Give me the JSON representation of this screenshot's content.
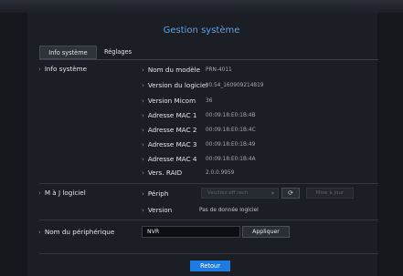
{
  "title": "Gestion système",
  "tabs": [
    {
      "label": "Info système",
      "active": true
    },
    {
      "label": "Réglages",
      "active": false
    }
  ],
  "info_section": {
    "label": "Info système",
    "rows": [
      {
        "label": "Nom du modèle",
        "value": "PRN-4011"
      },
      {
        "label": "Version du logiciel",
        "value": "v0.54_160909214819"
      },
      {
        "label": "Version Micom",
        "value": "36"
      },
      {
        "label": "Adresse MAC 1",
        "value": "00:09:18:E0:1B:4B"
      },
      {
        "label": "Adresse MAC 2",
        "value": "00:09:18:E0:1B:4C"
      },
      {
        "label": "Adresse MAC 3",
        "value": "00:09:18:E0:1B:49"
      },
      {
        "label": "Adresse MAC 4",
        "value": "00:09:18:E0:1B:4A"
      },
      {
        "label": "Vers. RAID",
        "value": "2.0.0.9959"
      }
    ]
  },
  "update_section": {
    "label": "M à J logiciel",
    "periph_label": "Périph",
    "periph_placeholder": "Veuillez eff rech",
    "refresh_icon": "refresh-icon",
    "update_button": "Mise à jour",
    "version_label": "Version",
    "version_value": "Pas de donnée logiciel"
  },
  "device_name_section": {
    "label": "Nom du périphérique",
    "value": "NVR",
    "apply_button": "Appliquer"
  },
  "back_button": "Retour",
  "colors": {
    "accent": "#4aa6ff",
    "primary_button": "#1e7be0",
    "background": "#15171c"
  }
}
